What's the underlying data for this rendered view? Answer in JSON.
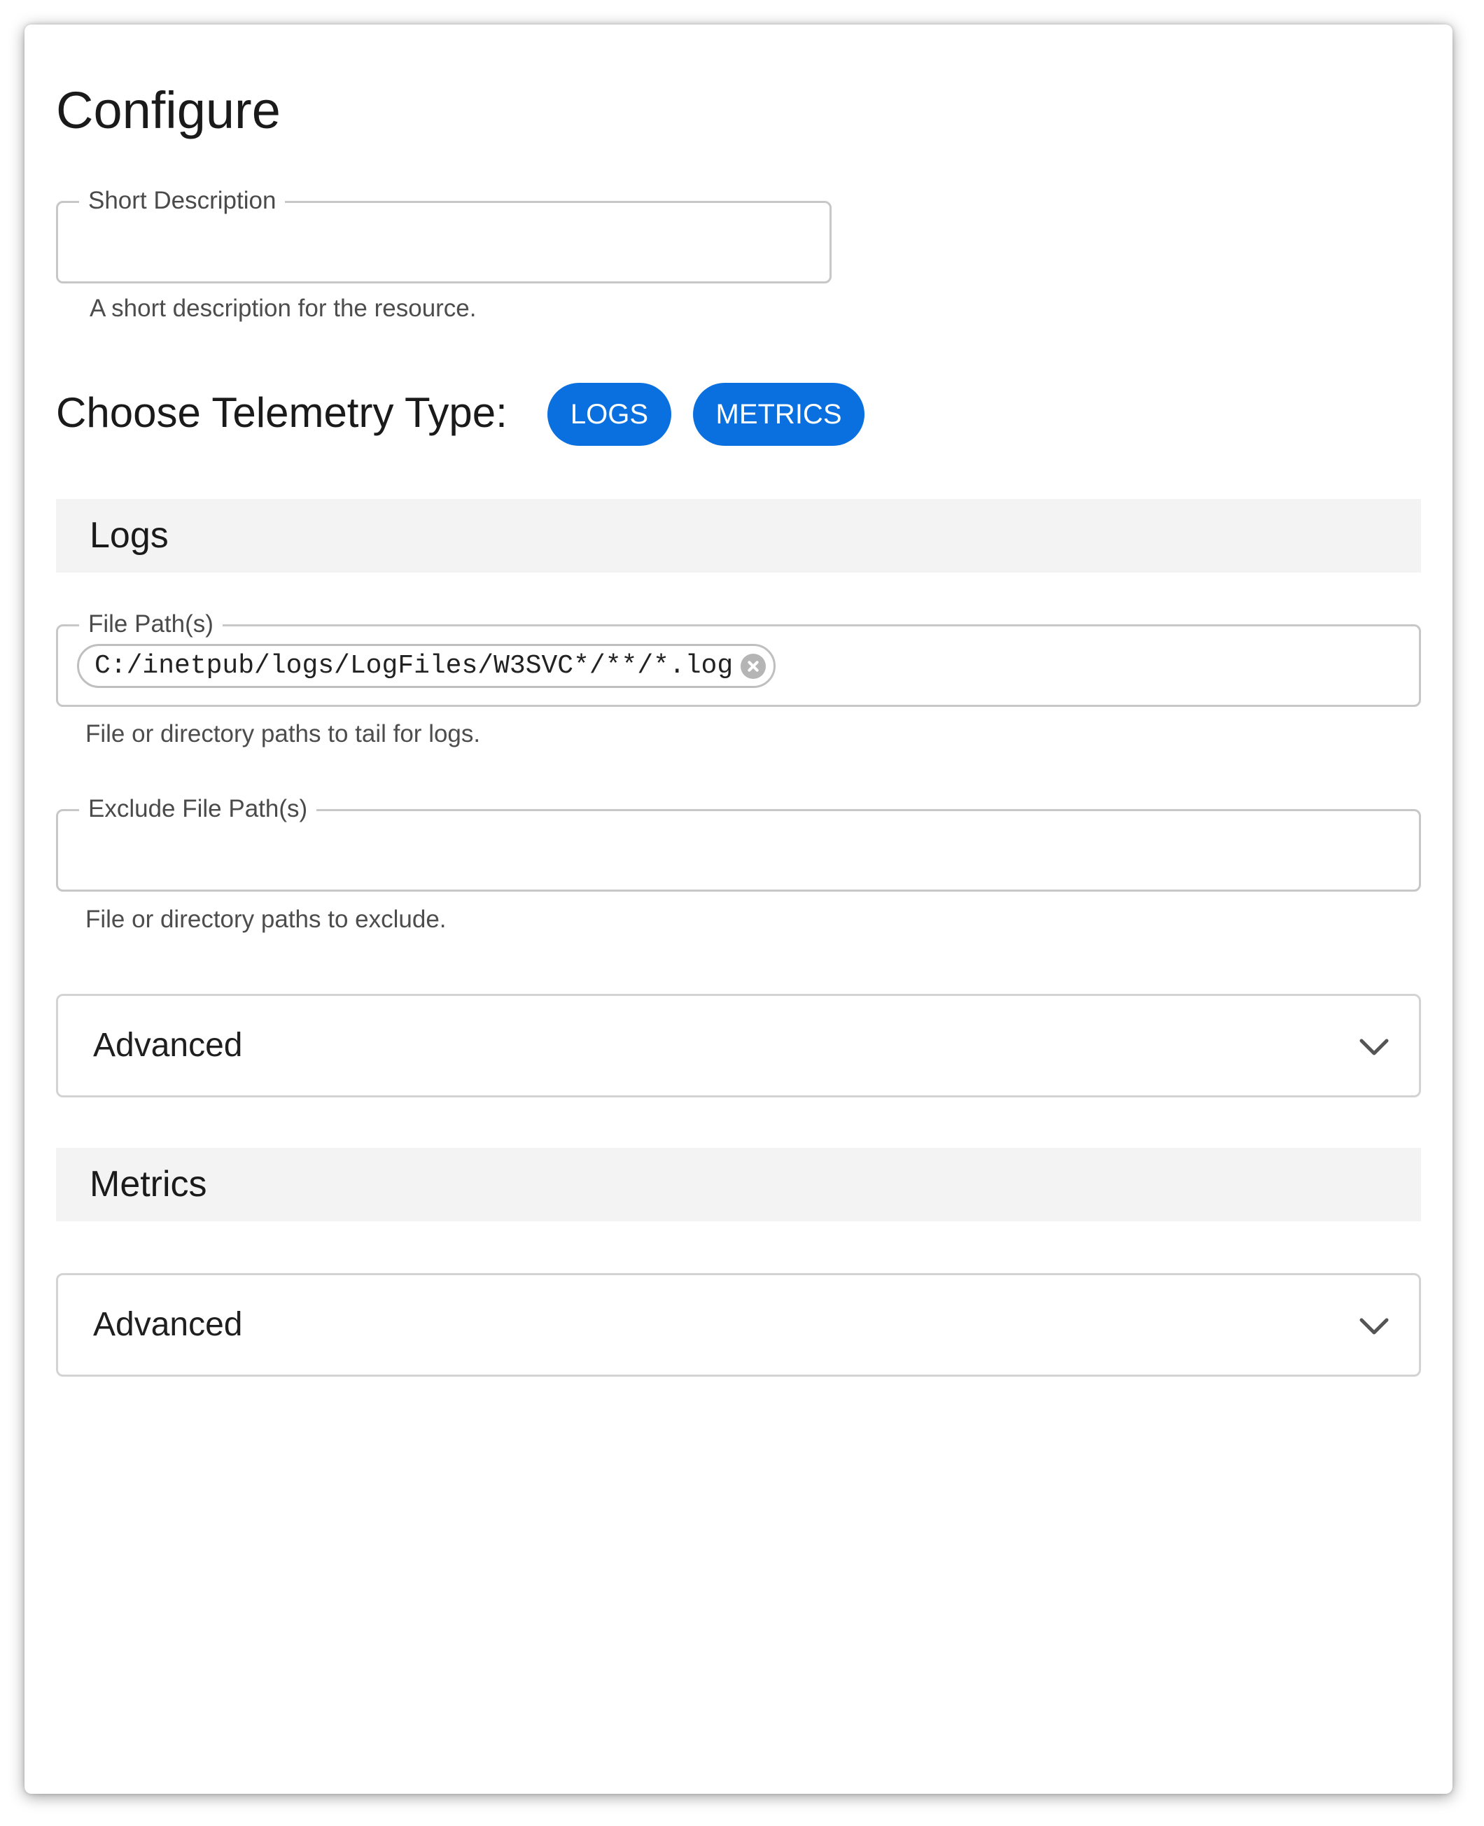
{
  "page": {
    "title": "Configure"
  },
  "short_description": {
    "label": "Short Description",
    "value": "",
    "help": "A short description for the resource."
  },
  "telemetry": {
    "label": "Choose Telemetry Type:",
    "options": [
      "LOGS",
      "METRICS"
    ]
  },
  "logs": {
    "header": "Logs",
    "file_paths": {
      "label": "File Path(s)",
      "chips": [
        "C:/inetpub/logs/LogFiles/W3SVC*/**/*.log"
      ],
      "help": "File or directory paths to tail for logs."
    },
    "exclude_paths": {
      "label": "Exclude File Path(s)",
      "value": "",
      "help": "File or directory paths to exclude."
    },
    "advanced": {
      "label": "Advanced",
      "icon": "chevron-down-icon"
    }
  },
  "metrics": {
    "header": "Metrics",
    "advanced": {
      "label": "Advanced",
      "icon": "chevron-down-icon"
    }
  },
  "colors": {
    "accent": "#0a70e0",
    "section_header_bg": "#f3f3f3",
    "border": "#c7c7c7"
  }
}
